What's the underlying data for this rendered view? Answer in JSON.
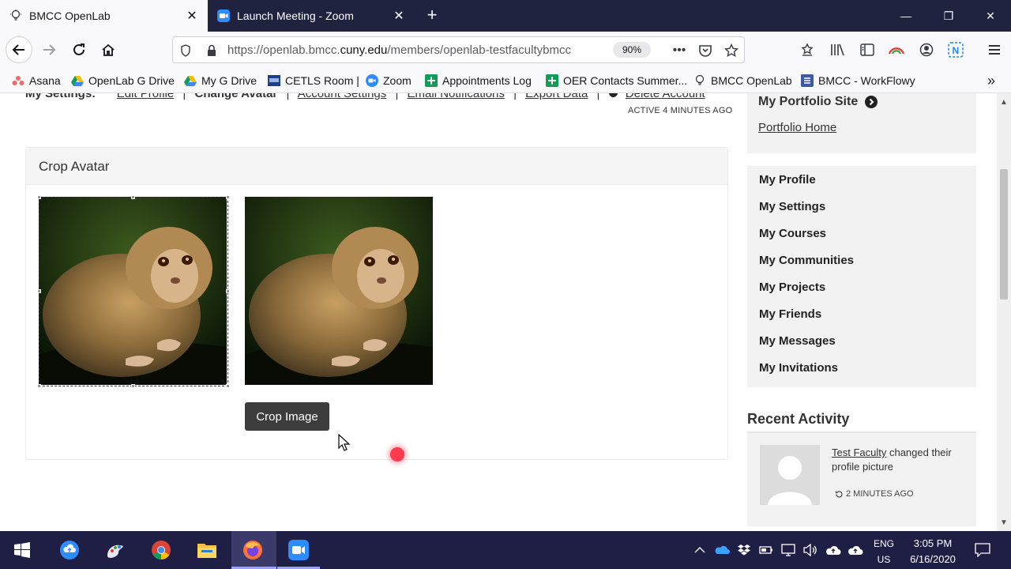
{
  "browser": {
    "tabs": [
      {
        "label": "BMCC OpenLab",
        "icon": "lightbulb-icon",
        "active": true
      },
      {
        "label": "Launch Meeting - Zoom",
        "icon": "zoom-icon",
        "active": false
      }
    ],
    "url_prefix": "https://openlab.bmcc.",
    "url_domain": "cuny.edu",
    "url_suffix": "/members/openlab-testfacultybmcc",
    "zoom": "90%",
    "bookmarks": [
      {
        "label": "Asana",
        "icon": "asana-icon"
      },
      {
        "label": "OpenLab G Drive",
        "icon": "google-drive-icon"
      },
      {
        "label": "My G Drive",
        "icon": "google-drive-icon"
      },
      {
        "label": "CETLS Room |",
        "icon": "cetls-icon"
      },
      {
        "label": "Zoom",
        "icon": "zoom-icon"
      },
      {
        "label": "Appointments Log",
        "icon": "google-sheets-icon"
      },
      {
        "label": "OER Contacts Summer...",
        "icon": "google-sheets-icon"
      },
      {
        "label": "BMCC OpenLab",
        "icon": "lightbulb-icon"
      },
      {
        "label": "BMCC - WorkFlowy",
        "icon": "workflowy-icon"
      }
    ]
  },
  "settings": {
    "label": "My Settings:",
    "links": [
      "Edit Profile",
      "Change Avatar",
      "Account Settings",
      "Email Notifications",
      "Export Data",
      "Delete Account"
    ],
    "active_stamp": "ACTIVE 4 MINUTES AGO"
  },
  "crop": {
    "title": "Crop Avatar",
    "button": "Crop Image"
  },
  "sidebar": {
    "portfolio_title": "My Portfolio Site",
    "portfolio_home": "Portfolio Home",
    "menu": [
      "My Profile",
      "My Settings",
      "My Courses",
      "My Communities",
      "My Projects",
      "My Friends",
      "My Messages",
      "My Invitations"
    ],
    "recent_title": "Recent Activity",
    "recent_user": "Test Faculty",
    "recent_action": " changed their profile picture",
    "recent_time": "2 MINUTES AGO"
  },
  "taskbar": {
    "lang_line1": "ENG",
    "lang_line2": "US",
    "time": "3:05 PM",
    "date": "6/16/2020"
  }
}
